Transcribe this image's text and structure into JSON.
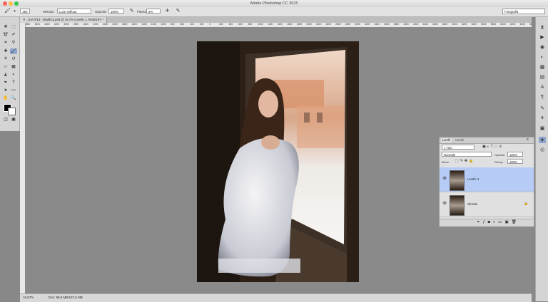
{
  "window": {
    "title": "Adobe Photoshop CC 2015"
  },
  "options": {
    "brush_size": "250",
    "method_label": "Metodo:",
    "method_value": "Luce soffusa",
    "opacity_label": "Opacità:",
    "opacity_value": "100%",
    "flow_label": "Flusso:",
    "flow_value": "6%",
    "workspace": "Fotografia"
  },
  "document": {
    "tab_label": "_GIA7013 - Modifica.psd @ 16,7% (Livello 1, RGB/16*) *"
  },
  "ruler": {
    "h_ticks": [
      "3800",
      "3600",
      "3400",
      "3200",
      "3000",
      "2800",
      "2600",
      "2400",
      "2200",
      "2000",
      "1800",
      "1600",
      "1400",
      "1200",
      "1000",
      "800",
      "600",
      "400",
      "200",
      "0",
      "200",
      "400",
      "600",
      "800",
      "1000",
      "1200",
      "1400",
      "1600",
      "1800",
      "2000",
      "2200",
      "2400",
      "2600",
      "2800",
      "3000",
      "3200",
      "3400",
      "3600",
      "3800",
      "4000",
      "4200",
      "4400",
      "4600",
      "4800",
      "5000",
      "5200",
      "5400",
      "5600",
      "5800",
      "6000",
      "6200",
      "6400",
      "6600",
      "6800"
    ]
  },
  "layers_panel": {
    "tab_layers": "Livelli",
    "tab_channels": "Canali",
    "filter_label": "Tipo",
    "blend_mode": "Normale",
    "opacity_label": "Opacità:",
    "opacity_value": "100%",
    "lock_label": "Blocc.:",
    "fill_label": "Riemp.:",
    "fill_value": "100%",
    "layers": [
      {
        "name": "Livello 1",
        "selected": true
      },
      {
        "name": "Sfondo",
        "selected": false
      }
    ]
  },
  "status": {
    "zoom": "16,67%",
    "doc_info": "Doc: 98,8 MB/197,5 MB"
  },
  "colors": {
    "selection": "#b6ccf6",
    "canvas": "#8a8a8a"
  }
}
